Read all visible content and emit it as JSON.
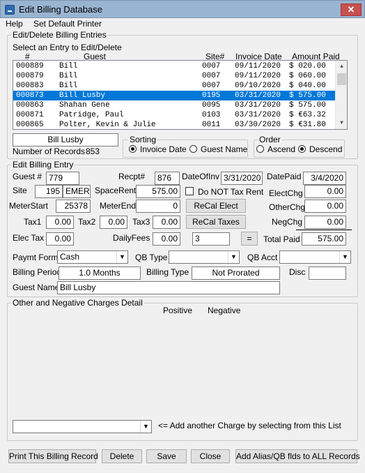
{
  "window": {
    "title": "Edit Billing Database",
    "close_glyph": "✕"
  },
  "menu": {
    "help": "Help",
    "set_default_printer": "Set Default Printer"
  },
  "entries_group": {
    "title": "Edit/Delete Billing Entries",
    "prompt": "Select an Entry to Edit/Delete",
    "columns": {
      "num": "#",
      "guest": "Guest",
      "site": "Site#",
      "invoice_date": "Invoice Date",
      "amount_paid": "Amount Paid"
    },
    "rows": [
      {
        "num": "000889",
        "guest": "Bill",
        "site": "0007",
        "date": "09/11/2020",
        "amount": "$ 020.00"
      },
      {
        "num": "000879",
        "guest": "Bill",
        "site": "0007",
        "date": "09/11/2020",
        "amount": "$ 060.00"
      },
      {
        "num": "000883",
        "guest": "Bill",
        "site": "0007",
        "date": "09/10/2020",
        "amount": "$ 040.00"
      },
      {
        "num": "000873",
        "guest": "Bill Lusby",
        "site": "0195",
        "date": "03/31/2020",
        "amount": "$ 575.00",
        "selected": true
      },
      {
        "num": "000863",
        "guest": "Shahan Gene",
        "site": "0095",
        "date": "03/31/2020",
        "amount": "$ 575.00"
      },
      {
        "num": "000871",
        "guest": "Patridge, Paul",
        "site": "0103",
        "date": "03/31/2020",
        "amount": "$ €63.32"
      },
      {
        "num": "000865",
        "guest": "Polter, Kevin & Julie",
        "site": "0011",
        "date": "03/30/2020",
        "amount": "$ €31.80"
      }
    ],
    "search_value": "Bill Lusby",
    "record_count_label": "Number of Records",
    "record_count": "853",
    "sorting": {
      "title": "Sorting",
      "invoice_date": "Invoice Date",
      "guest_name": "Guest Name",
      "selected": "invoice_date"
    },
    "order": {
      "title": "Order",
      "ascend": "Ascend",
      "descend": "Descend",
      "selected": "descend"
    }
  },
  "billing_entry": {
    "title": "Edit Billing Entry",
    "guest_num_label": "Guest #",
    "guest_num": "779",
    "recpt_label": "Recpt#",
    "recpt": "876",
    "date_of_inv_label": "DateOfInv",
    "date_of_inv": "3/31/2020",
    "date_paid_label": "DatePaid",
    "date_paid": "3/4/2020",
    "site_label": "Site",
    "site_num": "195",
    "site_name": "EMERG",
    "space_rent_label": "SpaceRent",
    "space_rent": "575.00",
    "no_tax_rent_label": "Do NOT Tax Rent",
    "elect_chg_label": "ElectChg",
    "elect_chg": "0.00",
    "meter_start_label": "MeterStart",
    "meter_start": "25378",
    "meter_end_label": "MeterEnd",
    "meter_end": "0",
    "recal_elect_label": "ReCal Elect",
    "other_chg_label": "OtherChg",
    "other_chg": "0.00",
    "tax1_label": "Tax1",
    "tax1": "0.00",
    "tax2_label": "Tax2",
    "tax2": "0.00",
    "tax3_label": "Tax3",
    "tax3": "0.00",
    "recal_taxes_label": "ReCal Taxes",
    "neg_chg_label": "NegChg",
    "neg_chg": "0.00",
    "elec_tax_label": "Elec Tax",
    "elec_tax": "0.00",
    "daily_fees_label": "DailyFees",
    "daily_fees": "0.00",
    "daily_count": "3",
    "equals_label": "=",
    "total_paid_label": "Total Paid",
    "total_paid": "575.00",
    "paymt_form_label": "Paymt Form",
    "paymt_form": "Cash",
    "qb_type_label": "QB Type",
    "qb_type": "",
    "qb_acct_label": "QB Acct",
    "qb_acct": "",
    "billing_period_label": "Billing Period",
    "billing_period": "1.0 Months",
    "billing_type_label": "Billing Type",
    "billing_type": "Not Prorated",
    "disc_label": "Disc",
    "disc": "",
    "guest_name_label": "Guest Name",
    "guest_name": "Bill Lusby"
  },
  "charges_group": {
    "title": "Other and Negative Charges Detail",
    "positive": "Positive",
    "negative": "Negative",
    "add_charge_value": "",
    "add_charge_hint": "<= Add another Charge by selecting from this List"
  },
  "buttons": {
    "print": "Print This Billing Record",
    "delete": "Delete",
    "save": "Save",
    "close": "Close",
    "add_alias": "Add Alias/QB flds to ALL Records"
  }
}
